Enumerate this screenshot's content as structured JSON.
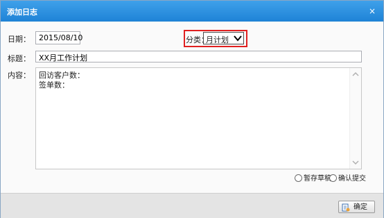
{
  "dialog": {
    "title": "添加日志",
    "close_glyph": "×"
  },
  "form": {
    "date_label": "日期：",
    "date_value": "2015/08/10",
    "category_label": "分类：",
    "category_value": "月计划",
    "title_label": "标题：",
    "title_value": "XX月工作计划",
    "content_label": "内容：",
    "content_lines": [
      "回访客户数：",
      "签单数："
    ]
  },
  "options": {
    "draft_label": "暂存草稿",
    "submit_label": "确认提交"
  },
  "footer": {
    "confirm_label": "确定"
  },
  "colors": {
    "titlebar": "#1e83d6",
    "highlight": "#e02020"
  },
  "icons": [
    "close-icon",
    "chevron-down-icon",
    "scroll-up-icon",
    "scroll-down-icon",
    "confirm-icon"
  ]
}
